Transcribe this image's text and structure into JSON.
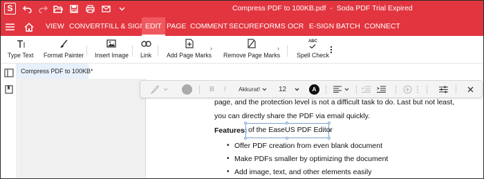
{
  "app": {
    "logo_letter": "S",
    "document_name": "Compress PDF to 100KB.pdf",
    "separator": "-",
    "app_status": "Soda PDF Trial Expired"
  },
  "quick_access": [
    "undo-icon",
    "redo-icon",
    "open-folder-icon",
    "save-icon",
    "print-icon",
    "email-icon",
    "chevron-down-icon"
  ],
  "menu": {
    "items": [
      "VIEW",
      "CONVERT",
      "FILL & SIGN",
      "EDIT",
      "PAGE",
      "COMMENT",
      "SECURE",
      "FORMS",
      "OCR",
      "E-SIGN",
      "BATCH",
      "CONNECT"
    ],
    "active": "EDIT"
  },
  "ribbon": {
    "type_text": "Type Text",
    "format_painter": "Format Painter",
    "insert_image": "Insert Image",
    "link": "Link",
    "add_page_marks": "Add Page Marks",
    "remove_page_marks": "Remove Page Marks",
    "spell_check": "Spell Check",
    "spell_icon_text": "ABC"
  },
  "doc_tab": {
    "label": "Compress PDF to 100KB*"
  },
  "format_toolbar": {
    "font_name": "Akkurat!",
    "font_size": "12",
    "text_color_letter": "A",
    "bold": "B",
    "italic": "I",
    "text_color_hex": "#000000"
  },
  "document": {
    "line1": "page, and the protection level is not a difficult task to do. Last but not least,",
    "line2": "you can directly share the PDF via email quickly.",
    "features_label": "Features:",
    "features_value": "of the EaseUS PDF Editor",
    "bullet_char": "•",
    "bullets": [
      "Offer PDF creation from even blank document",
      "Make PDFs smaller by optimizing the document",
      "Add image, text, and other elements easily"
    ]
  },
  "colors": {
    "brand_red": "#e2353f",
    "active_tab": "#f0585f",
    "doc_tab_bg": "#e7f0fb",
    "selection_border": "#7aa0cc"
  }
}
